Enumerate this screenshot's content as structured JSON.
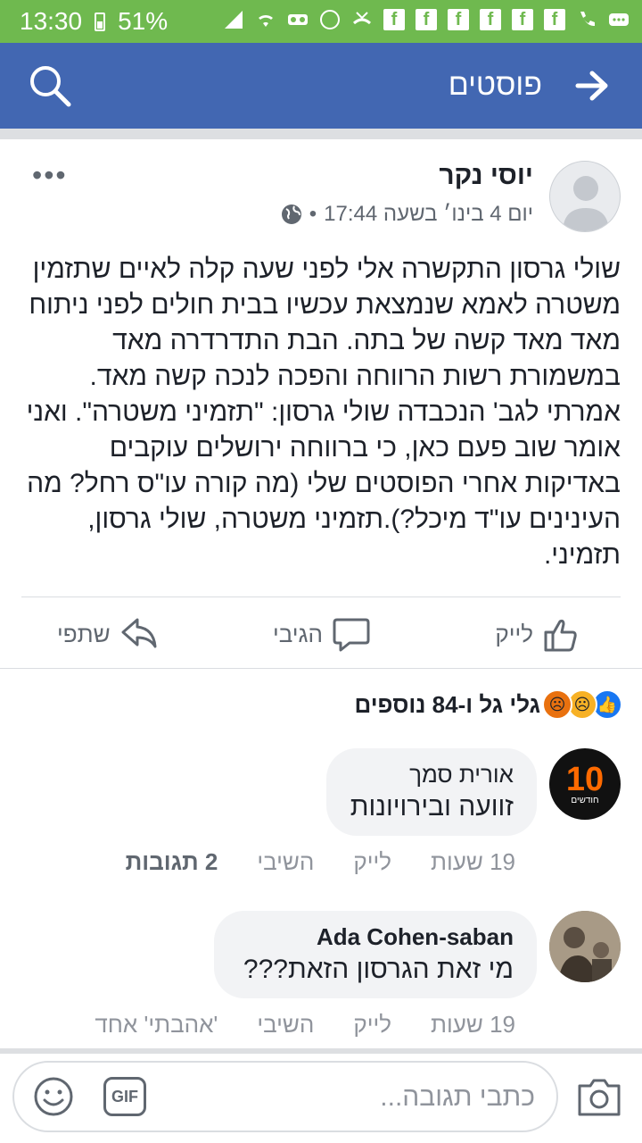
{
  "status_bar": {
    "time": "13:30",
    "battery": "51%"
  },
  "header": {
    "title": "פוסטים"
  },
  "post": {
    "author": "יוסי נקר",
    "timestamp": "יום 4 בינו׳ בשעה 17:44",
    "separator": "•",
    "body": "שולי גרסון התקשרה אלי לפני שעה קלה לאיים שתזמין משטרה לאמא שנמצאת עכשיו בבית חולים לפני ניתוח מאד מאד קשה של בתה. הבת התדרדרה מאד במשמורת רשות הרווחה והפכה לנכה קשה מאד. אמרתי לגב' הנכבדה שולי גרסון: \"תזמיני משטרה\". ואני אומר שוב פעם כאן, כי ברווחה ירושלים עוקבים באדיקות אחרי הפוסטים שלי (מה קורה עו\"ס רחל? מה העינינים עו\"ד מיכל?).תזמיני משטרה, שולי גרסון, תזמיני.",
    "actions": {
      "like": "לייק",
      "comment": "הגיבי",
      "share": "שתפי"
    },
    "reactions_text": "גלי גל ו-84 נוספים",
    "more_label": "•••"
  },
  "comments": [
    {
      "author": "אורית סמך",
      "text": "זוועה ובירויונות",
      "time": "19 שעות",
      "like": "לייק",
      "reply": "השיבי",
      "extra": "2 תגובות",
      "avatar_text": "10",
      "avatar_sub": "חודשים"
    },
    {
      "author": "Ada Cohen-saban",
      "text": "מי זאת הגרסון הזאת???",
      "time": "19 שעות",
      "like": "לייק",
      "reply": "השיבי",
      "extra": "'אהבתי' אחד"
    }
  ],
  "composer": {
    "placeholder": "כתבי תגובה...",
    "gif_label": "GIF"
  },
  "colors": {
    "status_bar": "#6fb94f",
    "app_bar": "#4267b2"
  }
}
